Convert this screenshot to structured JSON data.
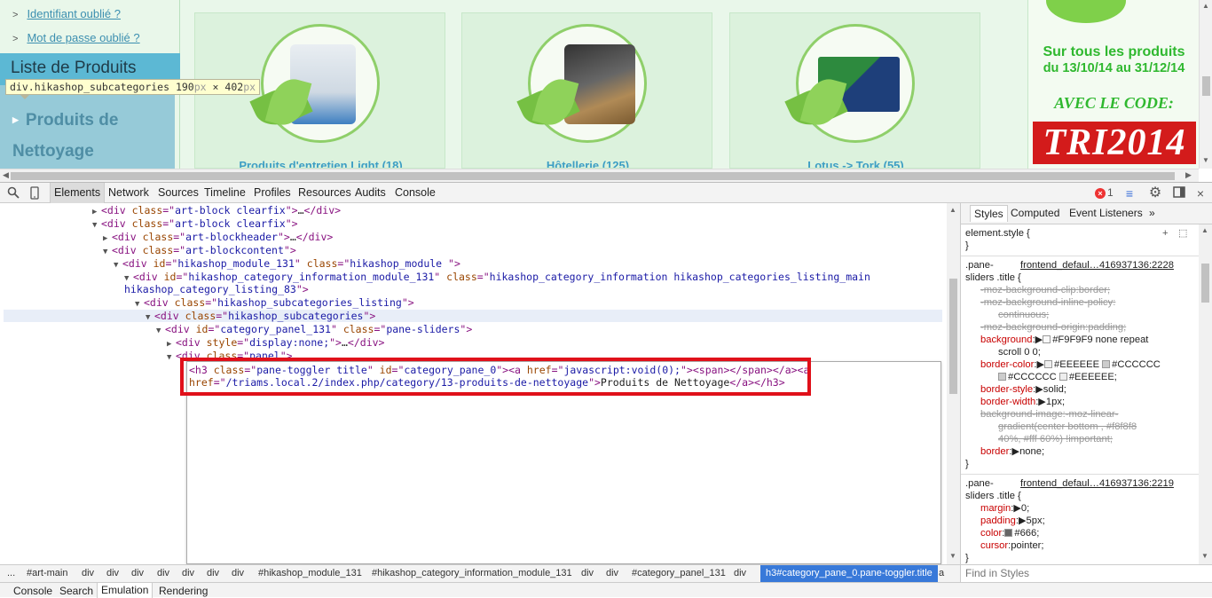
{
  "website": {
    "links": [
      "Identifiant oublié ?",
      "Mot de passe oublié ?"
    ],
    "list_heading": "Liste de Produits",
    "subcategory": "Produits de Nettoyage",
    "tooltip": {
      "selector": "div.hikashop_subcategories",
      "width": "190",
      "times": "×",
      "height": "402",
      "unit": "px"
    },
    "products": [
      {
        "title": "Produits d'entretien Light (18)",
        "color": "#dfe8ef"
      },
      {
        "title": "Hôtellerie (125)",
        "color": "#4a4a4a"
      },
      {
        "title": "Lotus -> Tork (55)",
        "color": "#2a4a8a"
      }
    ],
    "promo": {
      "line1": "Sur tous les produits",
      "line2": "du 13/10/14 au 31/12/14",
      "line3": "AVEC LE CODE:",
      "code": "TRI2014"
    }
  },
  "devtools": {
    "tabs": [
      "Elements",
      "Network",
      "Sources",
      "Timeline",
      "Profiles",
      "Resources",
      "Audits",
      "Console"
    ],
    "active_tab": "Elements",
    "error_count": "1",
    "dom": [
      {
        "tw": "▶",
        "parts": [
          [
            "tg",
            "<div "
          ],
          [
            "an",
            "class"
          ],
          [
            "tg",
            "=\""
          ],
          [
            "av",
            "art-block clearfix"
          ],
          [
            "tg",
            "\">"
          ],
          [
            "tx",
            "…"
          ],
          [
            "tg",
            "</div>"
          ]
        ]
      },
      {
        "tw": "▼",
        "parts": [
          [
            "tg",
            "<div "
          ],
          [
            "an",
            "class"
          ],
          [
            "tg",
            "=\""
          ],
          [
            "av",
            "art-block clearfix"
          ],
          [
            "tg",
            "\">"
          ]
        ]
      },
      {
        "tw": "▶",
        "parts": [
          [
            "tg",
            "<div "
          ],
          [
            "an",
            "class"
          ],
          [
            "tg",
            "=\""
          ],
          [
            "av",
            "art-blockheader"
          ],
          [
            "tg",
            "\">"
          ],
          [
            "tx",
            "…"
          ],
          [
            "tg",
            "</div>"
          ]
        ]
      },
      {
        "tw": "▼",
        "parts": [
          [
            "tg",
            "<div "
          ],
          [
            "an",
            "class"
          ],
          [
            "tg",
            "=\""
          ],
          [
            "av",
            "art-blockcontent"
          ],
          [
            "tg",
            "\">"
          ]
        ]
      },
      {
        "tw": "▼",
        "parts": [
          [
            "tg",
            "<div "
          ],
          [
            "an",
            "id"
          ],
          [
            "tg",
            "=\""
          ],
          [
            "av",
            "hikashop_module_131"
          ],
          [
            "tg",
            "\" "
          ],
          [
            "an",
            "class"
          ],
          [
            "tg",
            "=\""
          ],
          [
            "av",
            "hikashop_module "
          ],
          [
            "tg",
            "\">"
          ]
        ]
      },
      {
        "tw": "▼",
        "parts": [
          [
            "tg",
            "<div "
          ],
          [
            "an",
            "id"
          ],
          [
            "tg",
            "=\""
          ],
          [
            "av",
            "hikashop_category_information_module_131"
          ],
          [
            "tg",
            "\" "
          ],
          [
            "an",
            "class"
          ],
          [
            "tg",
            "=\""
          ],
          [
            "av",
            "hikashop_category_information hikashop_categories_listing_main"
          ]
        ]
      },
      {
        "tw": "",
        "parts": [
          [
            "av",
            "hikashop_category_listing_83"
          ],
          [
            "tg",
            "\">"
          ]
        ]
      },
      {
        "tw": "▼",
        "parts": [
          [
            "tg",
            "<div "
          ],
          [
            "an",
            "class"
          ],
          [
            "tg",
            "=\""
          ],
          [
            "av",
            "hikashop_subcategories_listing"
          ],
          [
            "tg",
            "\">"
          ]
        ]
      },
      {
        "tw": "▼",
        "parts": [
          [
            "tg",
            "<div "
          ],
          [
            "an",
            "class"
          ],
          [
            "tg",
            "=\""
          ],
          [
            "av",
            "hikashop_subcategories"
          ],
          [
            "tg",
            "\">"
          ]
        ]
      },
      {
        "tw": "▼",
        "parts": [
          [
            "tg",
            "<div "
          ],
          [
            "an",
            "id"
          ],
          [
            "tg",
            "=\""
          ],
          [
            "av",
            "category_panel_131"
          ],
          [
            "tg",
            "\" "
          ],
          [
            "an",
            "class"
          ],
          [
            "tg",
            "=\""
          ],
          [
            "av",
            "pane-sliders"
          ],
          [
            "tg",
            "\">"
          ]
        ]
      },
      {
        "tw": "▶",
        "parts": [
          [
            "tg",
            "<div "
          ],
          [
            "an",
            "style"
          ],
          [
            "tg",
            "=\""
          ],
          [
            "av",
            "display:none;"
          ],
          [
            "tg",
            "\">"
          ],
          [
            "tx",
            "…"
          ],
          [
            "tg",
            "</div>"
          ]
        ]
      },
      {
        "tw": "▼",
        "parts": [
          [
            "tg",
            "<div "
          ],
          [
            "an",
            "class"
          ],
          [
            "tg",
            "=\""
          ],
          [
            "av",
            "panel"
          ],
          [
            "tg",
            "\">"
          ]
        ]
      }
    ],
    "editor_lines": [
      [
        [
          "tg",
          "<h3 "
        ],
        [
          "an",
          "class"
        ],
        [
          "tg",
          "=\""
        ],
        [
          "av",
          "pane-toggler title"
        ],
        [
          "tg",
          "\" "
        ],
        [
          "an",
          "id"
        ],
        [
          "tg",
          "=\""
        ],
        [
          "av",
          "category_pane_0"
        ],
        [
          "tg",
          "\"><a "
        ],
        [
          "an",
          "href"
        ],
        [
          "tg",
          "=\""
        ],
        [
          "av",
          "javascript:void(0);"
        ],
        [
          "tg",
          "\"><span></span></a><a"
        ]
      ],
      [
        [
          "an",
          "href"
        ],
        [
          "tg",
          "=\""
        ],
        [
          "av",
          "/triams.local.2/index.php/category/13-produits-de-nettoyage"
        ],
        [
          "tg",
          "\">"
        ],
        [
          "tx",
          "Produits de Nettoyage"
        ],
        [
          "tg",
          "</a></h3>"
        ]
      ]
    ],
    "styles_tabs": [
      "Styles",
      "Computed",
      "Event Listeners",
      "»"
    ],
    "element_style": "element.style {",
    "close_brace": "}",
    "rule1": {
      "selector1": ".pane-",
      "selector2": "sliders .title {",
      "source": "frontend_defaul…416937136:2228",
      "props": [
        {
          "name": "-moz-background-clip",
          "value": "border;",
          "strike": true
        },
        {
          "name": "-moz-background-inline-policy",
          "value": "",
          "strike": true
        },
        {
          "name": "",
          "value": "continuous;",
          "strike": true,
          "indent": true
        },
        {
          "name": "-moz-background-origin",
          "value": "padding;",
          "strike": true
        },
        {
          "name": "background",
          "value": "#F9F9F9 none repeat",
          "arrow": true,
          "swatch": "#F9F9F9"
        },
        {
          "name": "",
          "value": "scroll 0 0;",
          "indent": true
        },
        {
          "name": "border-color",
          "value": "#EEEEEE",
          "arrow": true,
          "swatch": "#EEEEEE",
          "extra": "#CCCCCC",
          "extra_swatch": "#CCCCCC"
        },
        {
          "name": "",
          "value": "#CCCCCC",
          "indent": true,
          "swatch": "#CCCCCC",
          "extra": "#EEEEEE;",
          "extra_swatch": "#EEEEEE"
        },
        {
          "name": "border-style",
          "value": "solid;",
          "arrow": true
        },
        {
          "name": "border-width",
          "value": "1px;",
          "arrow": true
        },
        {
          "name": "background-image",
          "value": "-moz-linear-",
          "strike": true
        },
        {
          "name": "",
          "value": "gradient(center bottom , #f8f8f8",
          "strike": true,
          "indent": true
        },
        {
          "name": "",
          "value": "40%, #fff 60%) !important;",
          "strike": true,
          "indent": true
        },
        {
          "name": "border",
          "value": "none;",
          "arrow": true
        }
      ]
    },
    "rule2": {
      "selector1": ".pane-",
      "selector2": "sliders .title {",
      "source": "frontend_defaul…416937136:2219",
      "props": [
        {
          "name": "margin",
          "value": "0;",
          "arrow": true
        },
        {
          "name": "padding",
          "value": "5px;",
          "arrow": true
        },
        {
          "name": "color",
          "value": "#666;",
          "swatch": "#666666"
        },
        {
          "name": "cursor",
          "value": "pointer;"
        }
      ]
    },
    "breadcrumbs": [
      "...",
      "#art-main",
      "div",
      "div",
      "div",
      "div",
      "div",
      "div",
      "div",
      "#hikashop_module_131",
      "#hikashop_category_information_module_131",
      "div",
      "div",
      "#category_panel_131",
      "div",
      "h3#category_pane_0.pane-toggler.title",
      "a"
    ],
    "find_placeholder": "Find in Styles",
    "drawer_tabs": [
      "Console",
      "Search",
      "Emulation",
      "Rendering"
    ],
    "active_drawer": "Emulation"
  }
}
